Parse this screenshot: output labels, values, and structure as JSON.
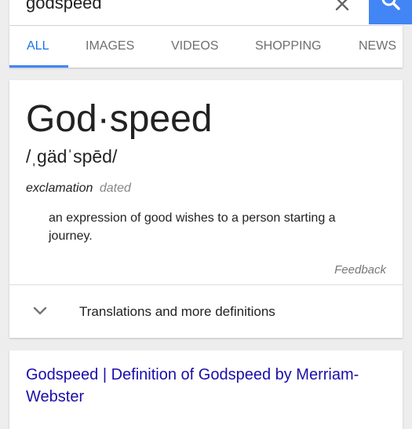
{
  "search": {
    "query": "godspeed",
    "clear_icon": "close-icon",
    "search_icon": "search-icon"
  },
  "tabs": [
    {
      "label": "ALL",
      "active": true
    },
    {
      "label": "IMAGES"
    },
    {
      "label": "VIDEOS"
    },
    {
      "label": "SHOPPING"
    },
    {
      "label": "NEWS"
    }
  ],
  "definition": {
    "headword": "God·speed",
    "pronunciation": "/ˌgädˈspēd/",
    "part_of_speech": "exclamation",
    "register": "dated",
    "text": "an expression of good wishes to a person starting a journey.",
    "feedback_label": "Feedback",
    "more_label": "Translations and more definitions",
    "more_icon": "chevron-down-icon"
  },
  "result": {
    "title": "Godspeed | Definition of Godspeed by Merriam-Webster"
  },
  "colors": {
    "accent": "#4285f4",
    "active_tab": "#1a73e8",
    "link": "#1a0dab",
    "background": "#ededed"
  }
}
